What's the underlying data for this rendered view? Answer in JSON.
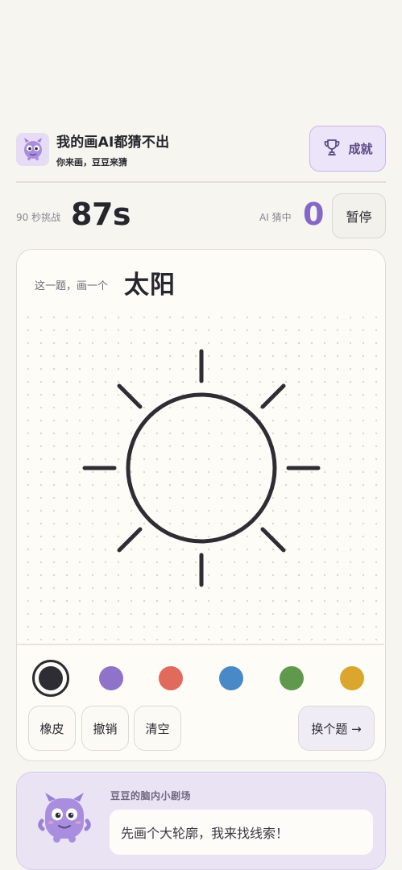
{
  "header": {
    "app_title": "我的画AI都猜不出",
    "app_subtitle": "你来画，豆豆来猜",
    "achievements_label": "成就",
    "logo_icon": "monster-mascot-icon",
    "trophy_icon": "trophy-icon"
  },
  "stats": {
    "challenge_label": "90 秒挑战",
    "time_remaining": "87s",
    "ai_label": "AI 猜中",
    "ai_guessed_count": "0",
    "pause_label": "暂停"
  },
  "prompt": {
    "prefix": "这一题，画一个",
    "word": "太阳"
  },
  "palette": {
    "selected_index": 0,
    "colors": [
      "#2d2d33",
      "#8f73c9",
      "#e06a5c",
      "#4a89c8",
      "#5f9a4c",
      "#dba62e"
    ]
  },
  "tools": {
    "eraser": "橡皮",
    "undo": "撤销",
    "clear": "清空",
    "next": "换个题 →"
  },
  "buddy": {
    "label": "豆豆的脑内小剧场",
    "message": "先画个大轮廓，我来找线索！",
    "avatar_icon": "monster-mascot-icon"
  },
  "colors": {
    "accent": "#8468c6",
    "accent_soft": "#ece4f8",
    "background": "#f6f5f0",
    "stroke": "#2d2d33"
  }
}
